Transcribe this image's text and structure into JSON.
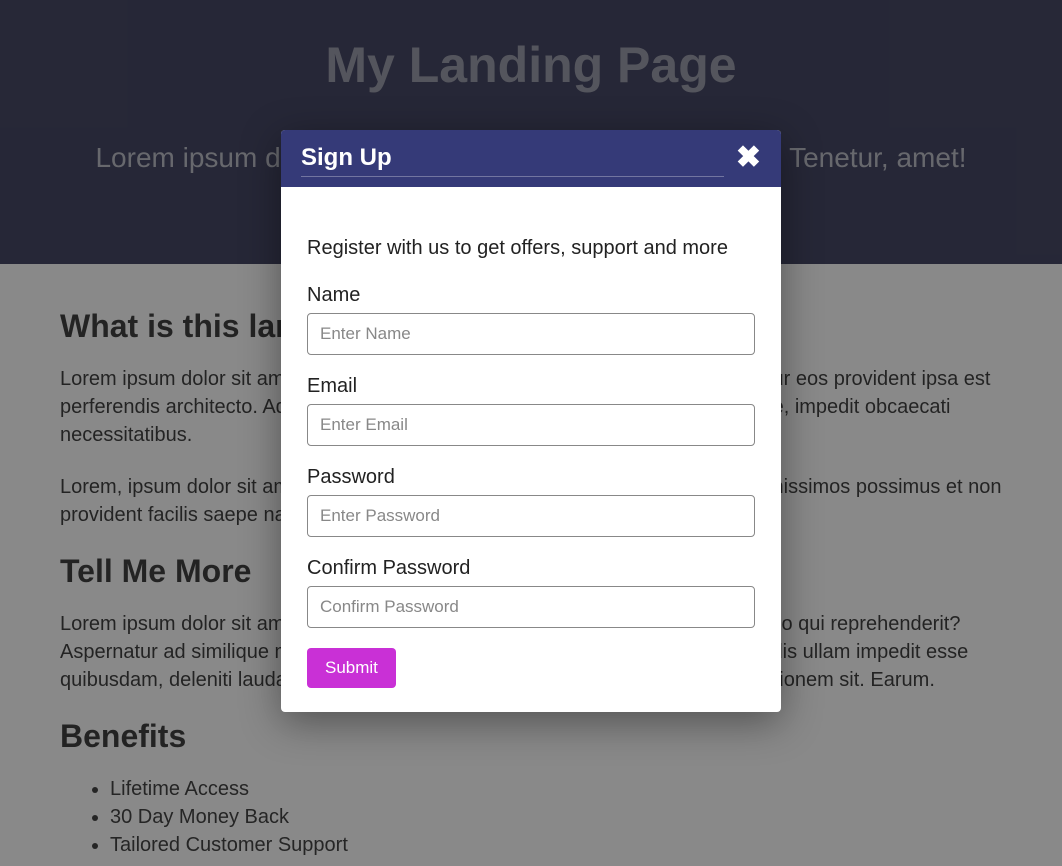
{
  "hero": {
    "title": "My Landing Page",
    "subtitle": "Lorem ipsum dolor, sit amet consectetur adipisicing elit. Tenetur, amet!"
  },
  "sections": {
    "what": {
      "heading": "What is this landing page about",
      "p1": "Lorem ipsum dolor sit amet consectetur adipisicing elit. Culpa aperiam consectetur eos provident ipsa est perferendis architecto. Adipisci aperiam porro iusto voluptatem mollitia at sapiente, impedit obcaecati necessitatibus.",
      "p2": "Lorem, ipsum dolor sit amet consectetur adipisicing elit. Debitis maxime illum dignissimos possimus et non provident facilis saepe nam aliquid."
    },
    "tell": {
      "heading": "Tell Me More",
      "p1": "Lorem ipsum dolor sit amet consectetur adipisicing elit. Nesciunt, tenetur explicabo qui reprehenderit? Aspernatur ad similique minus nesciunt quas placeat odio culpa, dolorem reiciendis ullam impedit esse quibusdam, deleniti laudantium praesentium quo ipsum sint ipsa veniam exercitationem sit. Earum."
    },
    "benefits": {
      "heading": "Benefits",
      "items": [
        "Lifetime Access",
        "30 Day Money Back",
        "Tailored Customer Support"
      ]
    }
  },
  "modal": {
    "title": "Sign Up",
    "intro": "Register with us to get offers, support and more",
    "fields": {
      "name": {
        "label": "Name",
        "placeholder": "Enter Name"
      },
      "email": {
        "label": "Email",
        "placeholder": "Enter Email"
      },
      "password": {
        "label": "Password",
        "placeholder": "Enter Password"
      },
      "confirm": {
        "label": "Confirm Password",
        "placeholder": "Confirm Password"
      }
    },
    "submit": "Submit"
  }
}
